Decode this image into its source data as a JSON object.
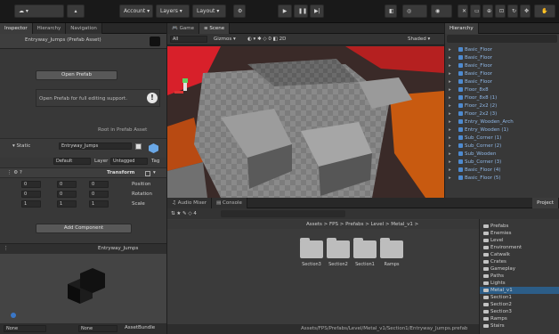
{
  "toolbar": {
    "account_menu": "▾",
    "account_label": "Account",
    "layers_label": "Layers",
    "layout_label": "Layout",
    "search_label": "Search",
    "layout_dropdown": "Default"
  },
  "inspector": {
    "tabs": [
      "Inspector",
      "Hierarchy",
      "Navigation"
    ],
    "title": "Entryway_Jumps (Prefab Asset)",
    "open_prefab": "Open Prefab",
    "info_text": "Open Prefab for full editing support.",
    "root_label": "Root in Prefab Asset",
    "object_name": "Entryway_Jumps",
    "static_label": "Static",
    "tag_label": "Tag",
    "tag_value": "Untagged",
    "layer_label": "Layer",
    "layer_value": "Default",
    "transform_title": "Transform",
    "position_label": "Position",
    "rotation_label": "Rotation",
    "scale_label": "Scale",
    "position": [
      "0",
      "0",
      "0"
    ],
    "rotation": [
      "0",
      "0",
      "0"
    ],
    "scale": [
      "1",
      "1",
      "1"
    ],
    "add_component": "Add Component",
    "preview_title": "Entryway_Jumps",
    "footer_left": "AssetBundle",
    "footer_none": "None",
    "footer_none2": "None"
  },
  "scene": {
    "tabs": [
      "Scene",
      "Game"
    ],
    "shading": "Shaded",
    "gizmos": "Gizmos",
    "search_all": "All"
  },
  "hierarchy": {
    "title": "Hierarchy",
    "items": [
      "Basic_Floor",
      "Basic_Floor",
      "Basic_Floor",
      "Basic_Floor",
      "Basic_Floor",
      "Floor_8x8",
      "Floor_8x8 (1)",
      "Floor_2x2 (2)",
      "Floor_2x2 (3)",
      "Entry_Wooden_Arch",
      "Entry_Wooden (1)",
      "Sub_Corner (1)",
      "Sub_Corner (2)",
      "Sub_Wooden",
      "Sub_Corner (3)",
      "Basic_Floor (4)",
      "Basic_Floor (5)"
    ]
  },
  "project": {
    "tabs": [
      "Project",
      "Console",
      "Audio Mixer"
    ],
    "breadcrumb": "Assets > FPS > Prefabs > Level > Metal_v1 >",
    "search_placeholder": "",
    "tree": [
      "Prefabs",
      "Enemies",
      "Level",
      "Environment",
      "Catwalk",
      "Crates",
      "Gameplay",
      "Paths",
      "Lights",
      "Metal_v1",
      "Section1",
      "Section2",
      "Section3",
      "Ramps",
      "Stairs"
    ],
    "assets": [
      "Ramps",
      "Section1",
      "Section2",
      "Section3"
    ],
    "footer_path": "Assets/FPS/Prefabs/Level/Metal_v1/Section1/Entryway_Jumps.prefab"
  }
}
